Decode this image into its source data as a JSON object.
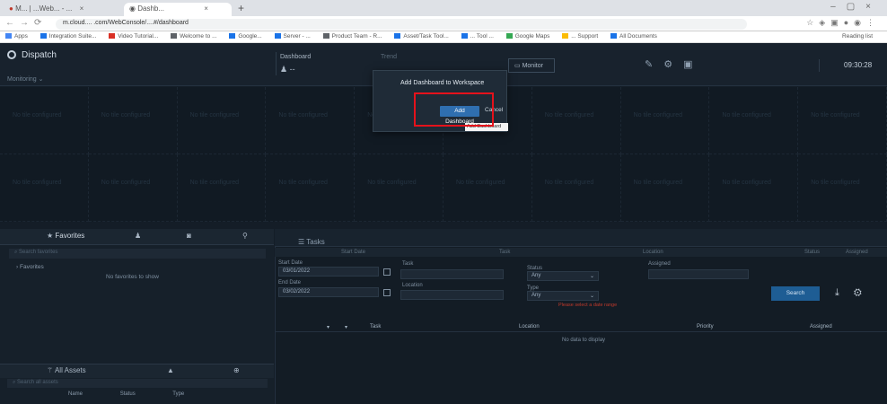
{
  "browser": {
    "tabs": [
      {
        "label": "M... | ...Web... - ...",
        "active": false
      },
      {
        "label": "Dashb...",
        "active": true
      }
    ],
    "url": "m.cloud.... .com/WebConsole/....#/dashboard",
    "bookmarks": [
      "Apps",
      "Integration Suite...",
      "Video Tutorial...",
      "Welcome to ...",
      "Google...",
      "Server - ...",
      "Product Team - R...",
      "...",
      "Asset/Task Tool...",
      "... Tool ...",
      "Google Maps",
      "... Support",
      "All Documents"
    ],
    "reading_list": "Reading list"
  },
  "header": {
    "app_name": "Dispatch",
    "monitoring_label": "Monitoring",
    "tile_label": "Dashboard",
    "tile_value": "--",
    "trend_label": "Trend",
    "monitor_button": "Monitor",
    "clock": "09:30:28"
  },
  "modal": {
    "title": "Add Dashboard to Workspace",
    "add_button": "Add Dashboard",
    "cancel_button": "Cancel",
    "tooltip": "Add Dashboard"
  },
  "grid": {
    "placeholder": "No tile configured"
  },
  "left_panel": {
    "favorites_tab": "Favorites",
    "search_placeholder": "Search favorites",
    "tree_root": "Favorites",
    "no_favorites": "No favorites to show",
    "sub_tab": "All Assets",
    "sub_search_placeholder": "Search all assets",
    "columns": [
      "Name",
      "Status",
      "Type"
    ]
  },
  "right_panel": {
    "tab_label": "Tasks",
    "column_headers": [
      "Start Date",
      "Task",
      "Location",
      "Status",
      "Assigned"
    ],
    "start_label": "Start Date",
    "start_value": "03/01/2022",
    "end_label": "End Date",
    "end_value": "03/02/2022",
    "task_label": "Task",
    "location_label": "Location",
    "status_label": "Status",
    "status_value": "Any",
    "type_label": "Type",
    "type_value": "Any",
    "assigned_label": "Assigned",
    "error_text": "Please select a date range",
    "search_button": "Search",
    "table_columns": [
      "Task",
      "Location",
      "Priority",
      "Assigned"
    ],
    "no_data": "No data to display"
  },
  "colors": {
    "accent": "#2f6fb0",
    "highlight": "#e5121b",
    "background": "#141d27"
  }
}
